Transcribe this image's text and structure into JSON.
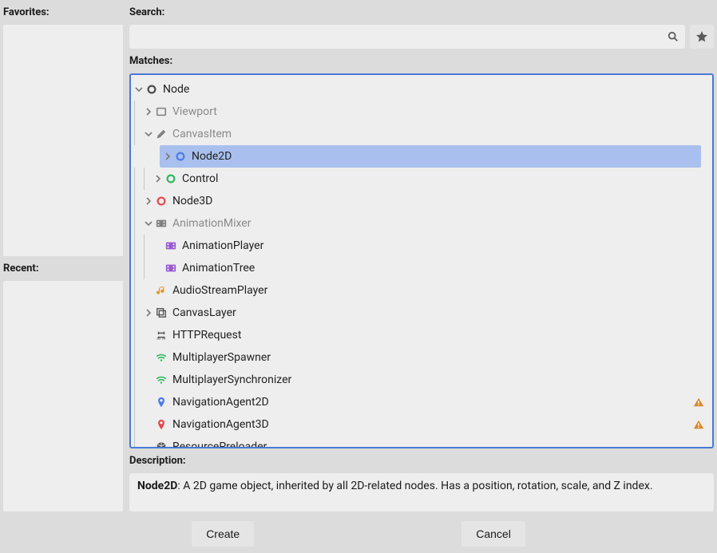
{
  "favorites": {
    "label": "Favorites:"
  },
  "recent": {
    "label": "Recent:"
  },
  "search": {
    "label": "Search:",
    "placeholder": ""
  },
  "matches": {
    "label": "Matches:",
    "tree": [
      {
        "id": "Node",
        "label": "Node",
        "depth": 0,
        "expander": "down",
        "icon": "ring-white",
        "dim": false,
        "selected": false,
        "warn": false
      },
      {
        "id": "Viewport",
        "label": "Viewport",
        "depth": 1,
        "expander": "right",
        "icon": "viewport",
        "dim": true,
        "selected": false,
        "warn": false
      },
      {
        "id": "CanvasItem",
        "label": "CanvasItem",
        "depth": 1,
        "expander": "down",
        "icon": "pencil",
        "dim": true,
        "selected": false,
        "warn": false
      },
      {
        "id": "Node2D",
        "label": "Node2D",
        "depth": 2,
        "expander": "right",
        "icon": "ring-blue",
        "dim": false,
        "selected": true,
        "warn": false
      },
      {
        "id": "Control",
        "label": "Control",
        "depth": 2,
        "expander": "right",
        "icon": "ring-green",
        "dim": false,
        "selected": false,
        "warn": false
      },
      {
        "id": "Node3D",
        "label": "Node3D",
        "depth": 1,
        "expander": "right",
        "icon": "ring-red",
        "dim": false,
        "selected": false,
        "warn": false
      },
      {
        "id": "AnimationMixer",
        "label": "AnimationMixer",
        "depth": 1,
        "expander": "down",
        "icon": "anim-gray",
        "dim": true,
        "selected": false,
        "warn": false
      },
      {
        "id": "AnimationPlayer",
        "label": "AnimationPlayer",
        "depth": 2,
        "expander": "none",
        "icon": "anim-purple",
        "dim": false,
        "selected": false,
        "warn": false
      },
      {
        "id": "AnimationTree",
        "label": "AnimationTree",
        "depth": 2,
        "expander": "none",
        "icon": "anim-purple",
        "dim": false,
        "selected": false,
        "warn": false
      },
      {
        "id": "AudioStreamPlayer",
        "label": "AudioStreamPlayer",
        "depth": 1,
        "expander": "none",
        "icon": "audio",
        "dim": false,
        "selected": false,
        "warn": false
      },
      {
        "id": "CanvasLayer",
        "label": "CanvasLayer",
        "depth": 1,
        "expander": "right",
        "icon": "canvaslayer",
        "dim": false,
        "selected": false,
        "warn": false
      },
      {
        "id": "HTTPRequest",
        "label": "HTTPRequest",
        "depth": 1,
        "expander": "none",
        "icon": "http",
        "dim": false,
        "selected": false,
        "warn": false
      },
      {
        "id": "MultiplayerSpawner",
        "label": "MultiplayerSpawner",
        "depth": 1,
        "expander": "none",
        "icon": "wifi-green",
        "dim": false,
        "selected": false,
        "warn": false
      },
      {
        "id": "MultiplayerSynchronizer",
        "label": "MultiplayerSynchronizer",
        "depth": 1,
        "expander": "none",
        "icon": "wifi-green",
        "dim": false,
        "selected": false,
        "warn": false
      },
      {
        "id": "NavigationAgent2D",
        "label": "NavigationAgent2D",
        "depth": 1,
        "expander": "none",
        "icon": "pin-blue",
        "dim": false,
        "selected": false,
        "warn": true
      },
      {
        "id": "NavigationAgent3D",
        "label": "NavigationAgent3D",
        "depth": 1,
        "expander": "none",
        "icon": "pin-red",
        "dim": false,
        "selected": false,
        "warn": true
      },
      {
        "id": "ResourcePreloader",
        "label": "ResourcePreloader",
        "depth": 1,
        "expander": "none",
        "icon": "cube",
        "dim": false,
        "selected": false,
        "warn": false
      }
    ]
  },
  "description": {
    "label": "Description:",
    "selected_name": "Node2D",
    "text": ": A 2D game object, inherited by all 2D-related nodes. Has a position, rotation, scale, and Z index."
  },
  "buttons": {
    "create": "Create",
    "cancel": "Cancel"
  },
  "icons": {
    "search": "search",
    "favorite": "star"
  }
}
